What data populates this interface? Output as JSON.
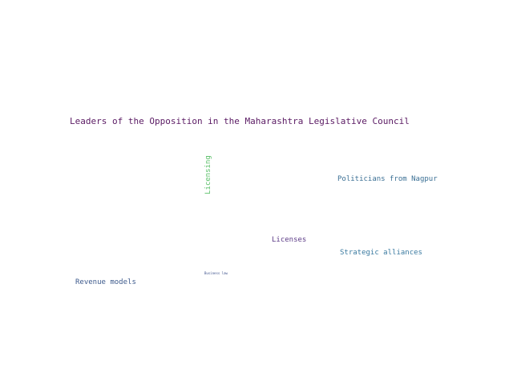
{
  "words": {
    "leaders": {
      "text": "Leaders of the Opposition in the Maharashtra Legislative Council",
      "color": "#5a1a63"
    },
    "licensing": {
      "text": "Licensing",
      "color": "#5cc06a"
    },
    "nagpur": {
      "text": "Politicians from Nagpur",
      "color": "#3a6f94"
    },
    "licenses": {
      "text": "Licenses",
      "color": "#5b3a86"
    },
    "alliances": {
      "text": "Strategic alliances",
      "color": "#3a7aa0"
    },
    "business": {
      "text": "Business law",
      "color": "#3a4f8a"
    },
    "revenue": {
      "text": "Revenue models",
      "color": "#3d5a8c"
    }
  }
}
